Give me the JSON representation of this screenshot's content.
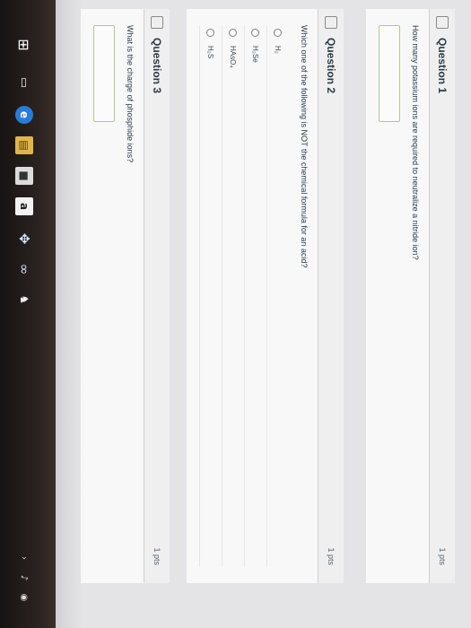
{
  "questions": [
    {
      "title": "Question 1",
      "points": "1 pts",
      "text": "How many potassium ions are required to neutralize a nitride ion?"
    },
    {
      "title": "Question 2",
      "points": "1 pts",
      "text": "Which one of the following is NOT the chemical formula for an acid?",
      "options": [
        "H₂",
        "H₂Se",
        "HAsO₄",
        "H₂S"
      ]
    },
    {
      "title": "Question 3",
      "points": "1 pts",
      "text": "What is the charge of phosphide ions?"
    }
  ],
  "taskbar": {
    "icons": [
      "windows-start-icon",
      "task-view-icon",
      "edge-browser-icon",
      "file-explorer-icon",
      "store-icon",
      "amazon-icon",
      "dropbox-icon",
      "link-icon",
      "game-icon"
    ],
    "tray": [
      "network-icon",
      "volume-icon",
      "chevron-icon"
    ]
  }
}
